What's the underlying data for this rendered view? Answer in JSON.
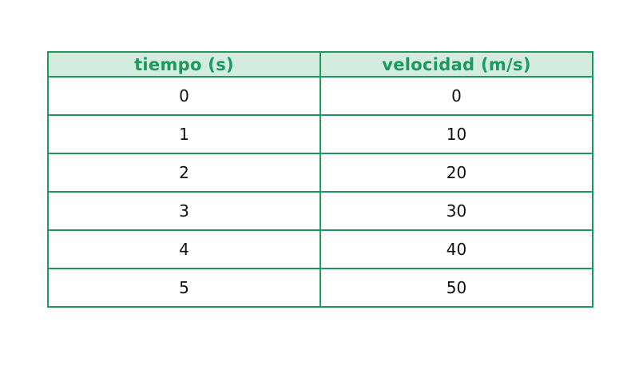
{
  "table": {
    "headers": [
      "tiempo (s)",
      "velocidad (m/s)"
    ],
    "rows": [
      [
        "0",
        "0"
      ],
      [
        "1",
        "10"
      ],
      [
        "2",
        "20"
      ],
      [
        "3",
        "30"
      ],
      [
        "4",
        "40"
      ],
      [
        "5",
        "50"
      ]
    ]
  },
  "colors": {
    "accent": "#1a9a5c",
    "header_bg": "#d4ebe0",
    "text": "#111111"
  }
}
